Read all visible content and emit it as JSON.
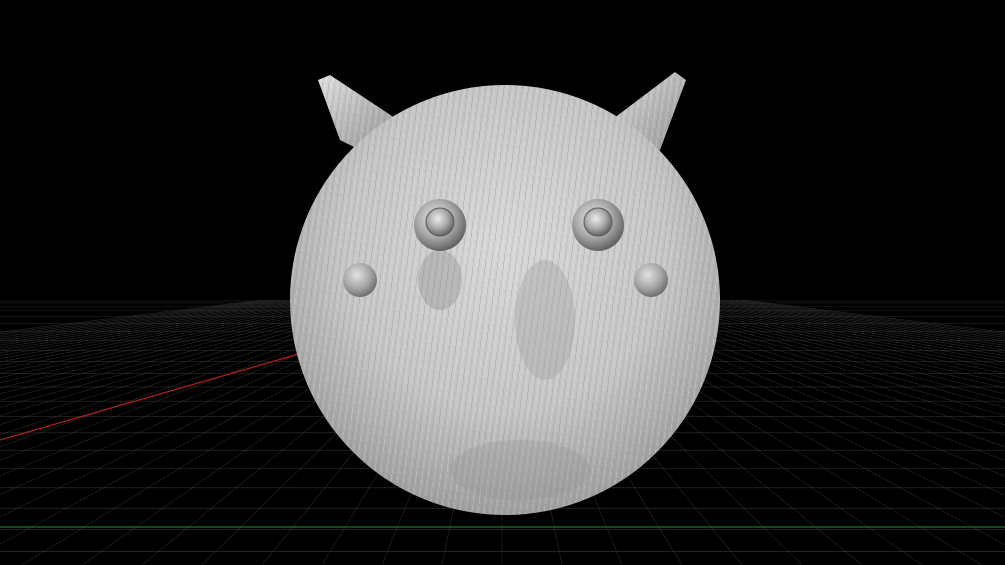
{
  "viewport": {
    "background_color": "#000000",
    "grid_color": "#4a4a4a",
    "x_axis_color": "#b02020",
    "z_axis_color": "#2e8b3a",
    "model_color": "#c9c9c9"
  },
  "model": {
    "description_icon": "furry-creature-model",
    "parts": [
      "body",
      "left-horn",
      "right-horn",
      "left-eye",
      "right-eye",
      "left-side-orb",
      "right-side-orb"
    ]
  }
}
